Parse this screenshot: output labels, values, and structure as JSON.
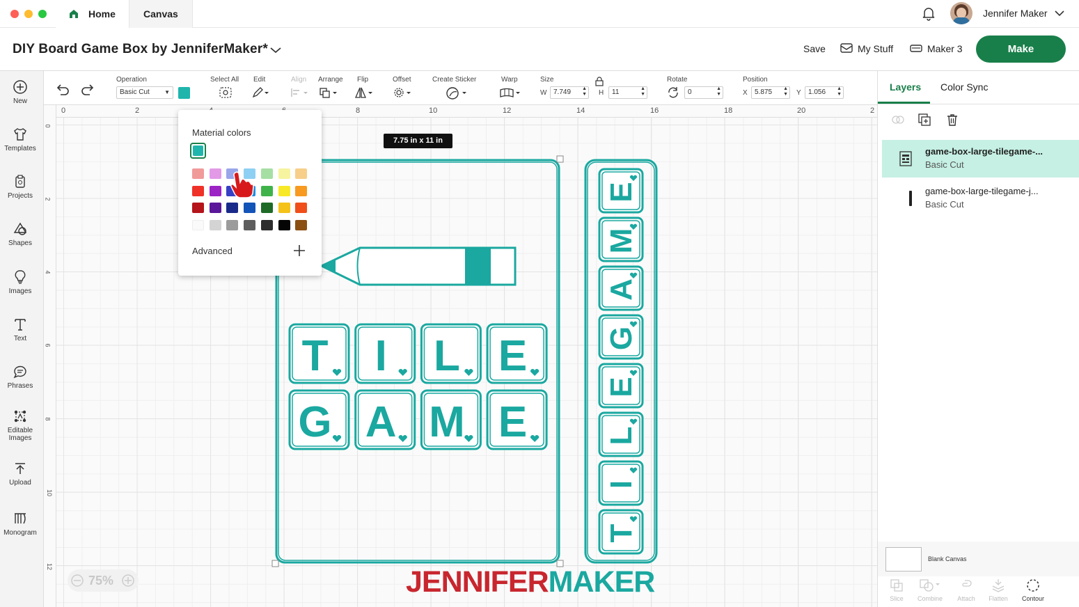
{
  "window": {
    "tabs": [
      {
        "label": "Home"
      },
      {
        "label": "Canvas"
      }
    ],
    "user": "Jennifer Maker"
  },
  "header": {
    "project_title": "DIY Board Game Box by JenniferMaker*",
    "save": "Save",
    "my_stuff": "My Stuff",
    "machine": "Maker 3",
    "make": "Make"
  },
  "sidebar": {
    "items": [
      {
        "label": "New"
      },
      {
        "label": "Templates"
      },
      {
        "label": "Projects"
      },
      {
        "label": "Shapes"
      },
      {
        "label": "Images"
      },
      {
        "label": "Text"
      },
      {
        "label": "Phrases"
      },
      {
        "label": "Editable Images"
      },
      {
        "label": "Upload"
      },
      {
        "label": "Monogram"
      }
    ]
  },
  "toolbar": {
    "operation_label": "Operation",
    "operation_value": "Basic Cut",
    "select_all": "Select All",
    "edit": "Edit",
    "align": "Align",
    "arrange": "Arrange",
    "flip": "Flip",
    "offset": "Offset",
    "create_sticker": "Create Sticker",
    "warp": "Warp",
    "size": "Size",
    "w_label": "W",
    "w_value": "7.749",
    "h_label": "H",
    "h_value": "11",
    "rotate": "Rotate",
    "rotate_value": "0",
    "position": "Position",
    "x_label": "X",
    "x_value": "5.875",
    "y_label": "Y",
    "y_value": "1.056",
    "color": "#1fb5ac"
  },
  "rulers": {
    "top": [
      "0",
      "2",
      "4",
      "6",
      "8",
      "10",
      "12",
      "14",
      "16",
      "18",
      "20",
      "2"
    ],
    "left": [
      "0",
      "2",
      "4",
      "6",
      "8",
      "10",
      "12"
    ]
  },
  "size_tooltip": "7.75  in x 11  in",
  "popup": {
    "title": "Material colors",
    "selected": "#1fb5ac",
    "advanced": "Advanced",
    "swatches": [
      [
        "#f19a9a",
        "#e29ae6",
        "#9aa6ea",
        "#8ed0f4",
        "#a6dfa4",
        "#f7f4a0",
        "#f7cf8a"
      ],
      [
        "#ef3127",
        "#9c23c4",
        "#3740c4",
        "#1f8ee0",
        "#3fb34a",
        "#f8e926",
        "#f79a1f"
      ],
      [
        "#b4141a",
        "#5a1799",
        "#192a8a",
        "#1254b8",
        "#1d6b26",
        "#f5c219",
        "#f04f19"
      ],
      [
        "#fafafa",
        "#d4d4d4",
        "#9b9b9b",
        "#5e5e5e",
        "#2d2d2d",
        "#050505",
        "#8b4f12"
      ]
    ]
  },
  "design": {
    "tiles_row1": [
      "T",
      "I",
      "L",
      "E"
    ],
    "tiles_row2": [
      "G",
      "A",
      "M",
      "E"
    ],
    "side_tiles": [
      "E",
      "M",
      "A",
      "G",
      "E",
      "L",
      "I",
      "T"
    ]
  },
  "zoom": "75%",
  "watermark": {
    "part1": "JENNIFER",
    "part2": "MAKER"
  },
  "right_panel": {
    "tabs": [
      {
        "label": "Layers"
      },
      {
        "label": "Color Sync"
      }
    ],
    "layers": [
      {
        "name": "game-box-large-tilegame-...",
        "op": "Basic Cut"
      },
      {
        "name": "game-box-large-tilegame-j...",
        "op": "Basic Cut"
      }
    ],
    "blank_canvas": "Blank Canvas",
    "bottom_tools": [
      {
        "label": "Slice"
      },
      {
        "label": "Combine"
      },
      {
        "label": "Attach"
      },
      {
        "label": "Flatten"
      },
      {
        "label": "Contour"
      }
    ]
  }
}
